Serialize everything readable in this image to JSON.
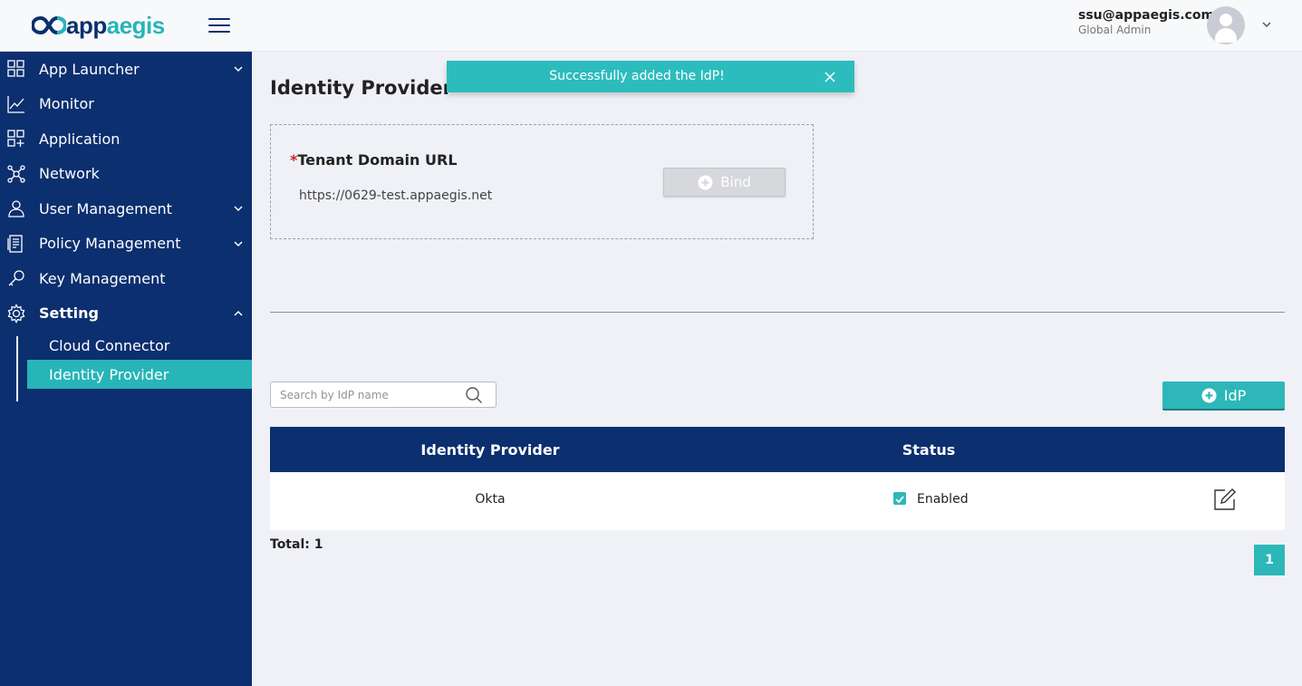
{
  "header": {
    "logo_part1": "app",
    "logo_part2": "aegis",
    "user_email": "ssu@appaegis.com",
    "user_role": "Global Admin"
  },
  "sidebar": {
    "items": [
      {
        "label": "App Launcher",
        "icon": "grid-icon",
        "expandable": true
      },
      {
        "label": "Monitor",
        "icon": "chart-icon",
        "expandable": false
      },
      {
        "label": "Application",
        "icon": "app-grid-plus-icon",
        "expandable": false
      },
      {
        "label": "Network",
        "icon": "network-icon",
        "expandable": false
      },
      {
        "label": "User Management",
        "icon": "user-icon",
        "expandable": true
      },
      {
        "label": "Policy Management",
        "icon": "document-icon",
        "expandable": true
      },
      {
        "label": "Key Management",
        "icon": "key-icon",
        "expandable": false
      },
      {
        "label": "Setting",
        "icon": "gear-icon",
        "expandable": true,
        "expanded": true
      }
    ],
    "sub_items": [
      {
        "label": "Cloud Connector",
        "active": false
      },
      {
        "label": "Identity Provider",
        "active": true
      }
    ]
  },
  "main": {
    "title": "Identity Provider",
    "toast": "Successfully added the IdP!",
    "domain_label": "Tenant Domain URL",
    "required_mark": "*",
    "domain_value": "https://0629-test.appaegis.net",
    "bind_label": "Bind",
    "search_placeholder": "Search by IdP name",
    "add_label": "IdP",
    "table": {
      "headers": [
        "Identity Provider",
        "Status"
      ],
      "rows": [
        {
          "provider": "Okta",
          "status": "Enabled",
          "checked": true
        }
      ]
    },
    "total": "Total: 1",
    "page": "1"
  },
  "colors": {
    "navy": "#0b2f6f",
    "teal": "#2db7b8",
    "background": "#eff1f6"
  }
}
